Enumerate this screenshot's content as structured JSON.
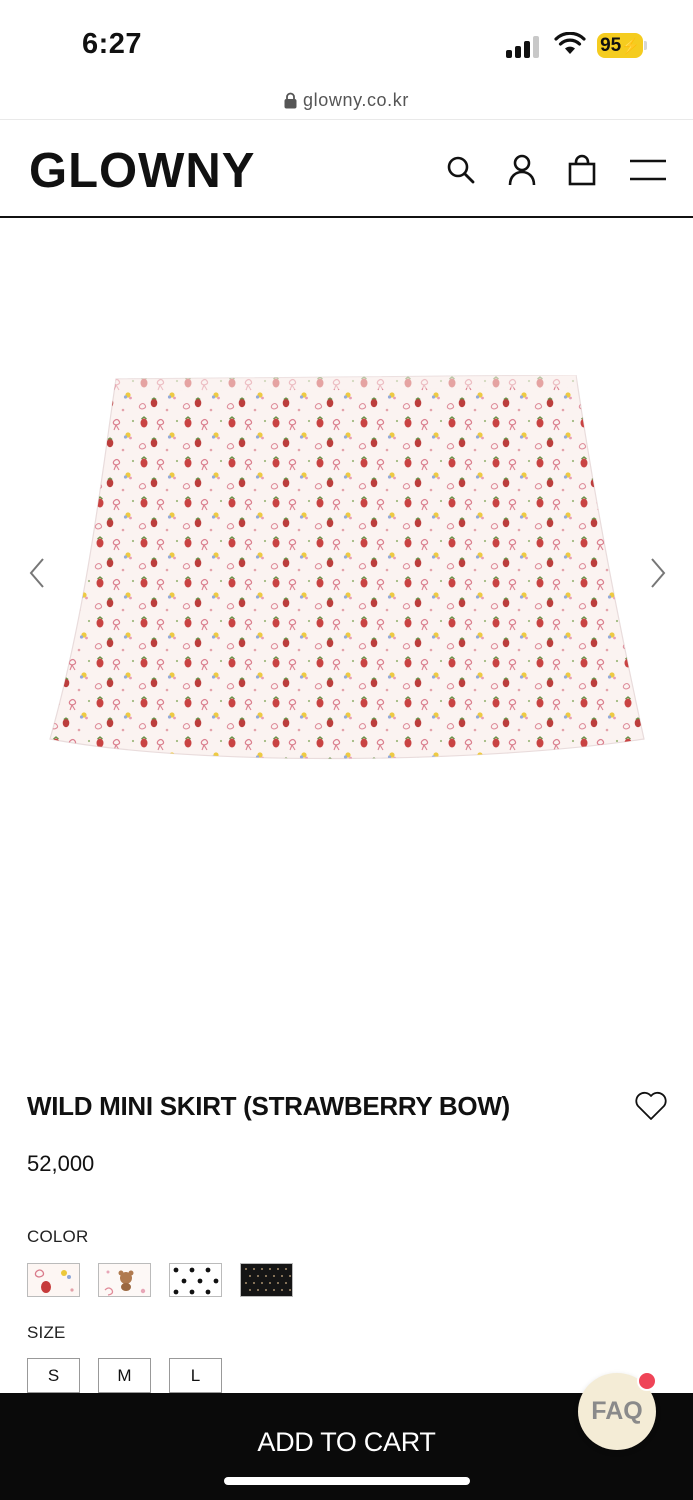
{
  "status_bar": {
    "time": "6:27",
    "battery": "95"
  },
  "browser": {
    "url": "glowny.co.kr"
  },
  "header": {
    "logo": "GLOWNY"
  },
  "product": {
    "title": "WILD MINI SKIRT (STRAWBERRY BOW)",
    "price": "52,000",
    "color_label": "COLOR",
    "size_label": "SIZE",
    "sizes": [
      "S",
      "M",
      "L"
    ],
    "swatches": [
      "strawberry-bow",
      "teddy-bear",
      "white-polka-dot",
      "black-polka-dot"
    ]
  },
  "footer": {
    "add_to_cart": "ADD TO CART",
    "faq": "FAQ"
  },
  "colors": {
    "accent_black": "#0a0a0a",
    "faq_bg": "#f4ecd6",
    "faq_dot": "#ef4457",
    "battery": "#f5cc1f"
  }
}
